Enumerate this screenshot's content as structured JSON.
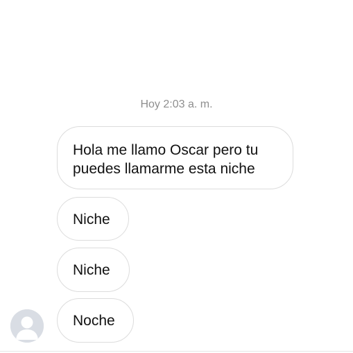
{
  "conversation": {
    "timestamp": "Hoy 2:03 a. m.",
    "messages": [
      {
        "line1": "Hola me llamo Oscar pero tu",
        "line2": "puedes llamarme esta niche"
      },
      {
        "text": "Niche"
      },
      {
        "text": "Niche"
      },
      {
        "text": "Noche"
      }
    ]
  },
  "sender": {
    "avatar_icon": "default-profile-icon"
  },
  "colors": {
    "timestamp": "#8e8e8e",
    "bubble_border": "#dcdcdc",
    "avatar_bg": "#d9dde4"
  }
}
